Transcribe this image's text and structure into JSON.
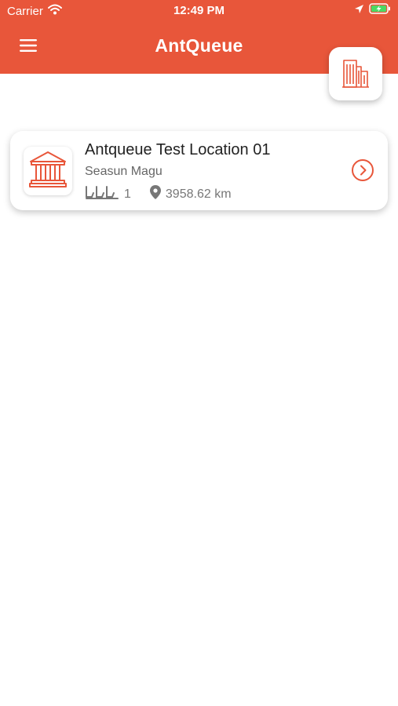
{
  "status_bar": {
    "carrier": "Carrier",
    "time": "12:49 PM",
    "icons": [
      "wifi-icon",
      "location-arrow-icon",
      "battery-charging-icon"
    ]
  },
  "header": {
    "title": "AntQueue",
    "menu_icon": "hamburger-menu-icon",
    "fab_icon": "buildings-icon"
  },
  "locations": [
    {
      "name": "Antqueue Test Location 01",
      "owner": "Seasun Magu",
      "queue_count": "1",
      "distance": "3958.62 km",
      "icon": "bank-icon"
    }
  ],
  "colors": {
    "accent": "#E8563A",
    "text_primary": "#222222",
    "text_secondary": "#666666"
  }
}
